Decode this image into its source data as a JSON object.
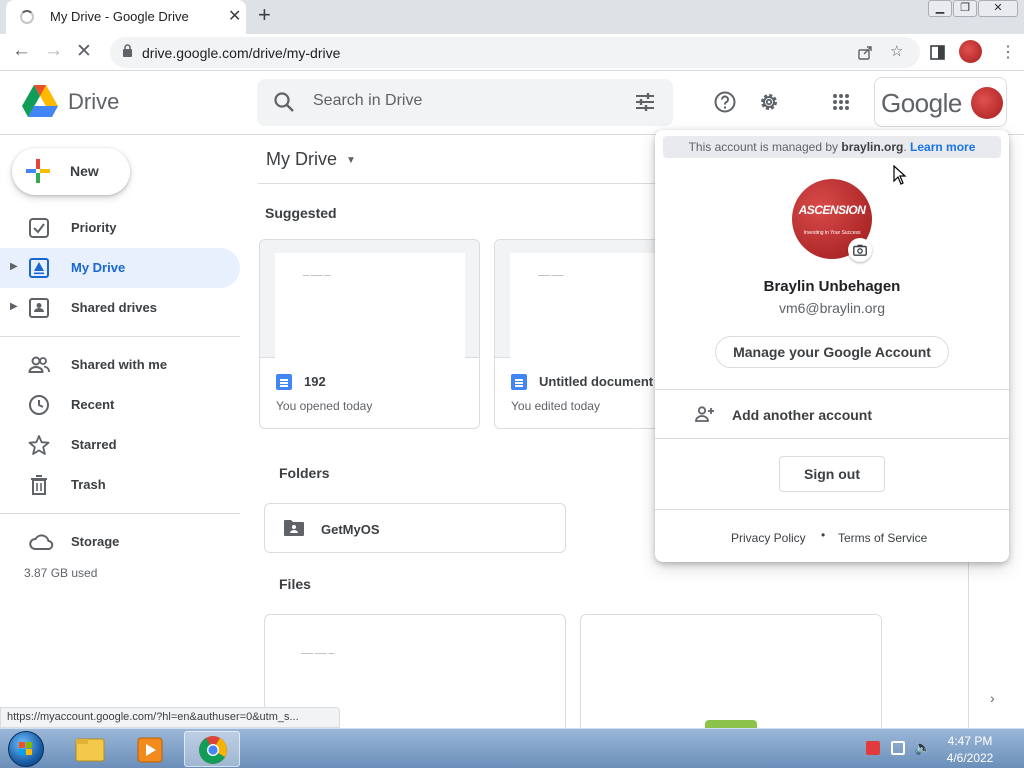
{
  "browser": {
    "tab_title": "My Drive - Google Drive",
    "url": "drive.google.com/drive/my-drive",
    "status_url": "https://myaccount.google.com/?hl=en&authuser=0&utm_s..."
  },
  "app": {
    "name": "Drive",
    "search_placeholder": "Search in Drive",
    "google_wordmark": "Google"
  },
  "sidebar": {
    "new_label": "New",
    "items": [
      {
        "label": "Priority",
        "icon": "priority-icon"
      },
      {
        "label": "My Drive",
        "icon": "my-drive-icon",
        "active": true
      },
      {
        "label": "Shared drives",
        "icon": "shared-drives-icon"
      },
      {
        "label": "Shared with me",
        "icon": "people-icon"
      },
      {
        "label": "Recent",
        "icon": "clock-icon"
      },
      {
        "label": "Starred",
        "icon": "star-icon"
      },
      {
        "label": "Trash",
        "icon": "trash-icon"
      },
      {
        "label": "Storage",
        "icon": "cloud-icon"
      }
    ],
    "storage_used": "3.87 GB used"
  },
  "main": {
    "title": "My Drive",
    "suggested_label": "Suggested",
    "suggested": [
      {
        "name": "192",
        "sub": "You opened today"
      },
      {
        "name": "Untitled document",
        "sub": "You edited today"
      }
    ],
    "folders_label": "Folders",
    "folders": [
      {
        "name": "GetMyOS"
      }
    ],
    "files_label": "Files"
  },
  "account_popup": {
    "managed_prefix": "This account is managed by",
    "managed_domain": "braylin.org",
    "learn_more": "Learn more",
    "avatar_text": "ASCENSION",
    "avatar_subtext": "Investing in Your Success",
    "name": "Braylin Unbehagen",
    "email": "vm6@braylin.org",
    "manage_label": "Manage your Google Account",
    "add_account_label": "Add another account",
    "sign_out_label": "Sign out",
    "privacy_label": "Privacy Policy",
    "separator": "•",
    "terms_label": "Terms of Service"
  },
  "taskbar": {
    "time": "4:47 PM",
    "date": "4/6/2022"
  },
  "colors": {
    "accent": "#1a73e8",
    "active_nav_bg": "#e8f0fe",
    "active_nav_text": "#1967d2",
    "avatar_red": "#c62828"
  }
}
